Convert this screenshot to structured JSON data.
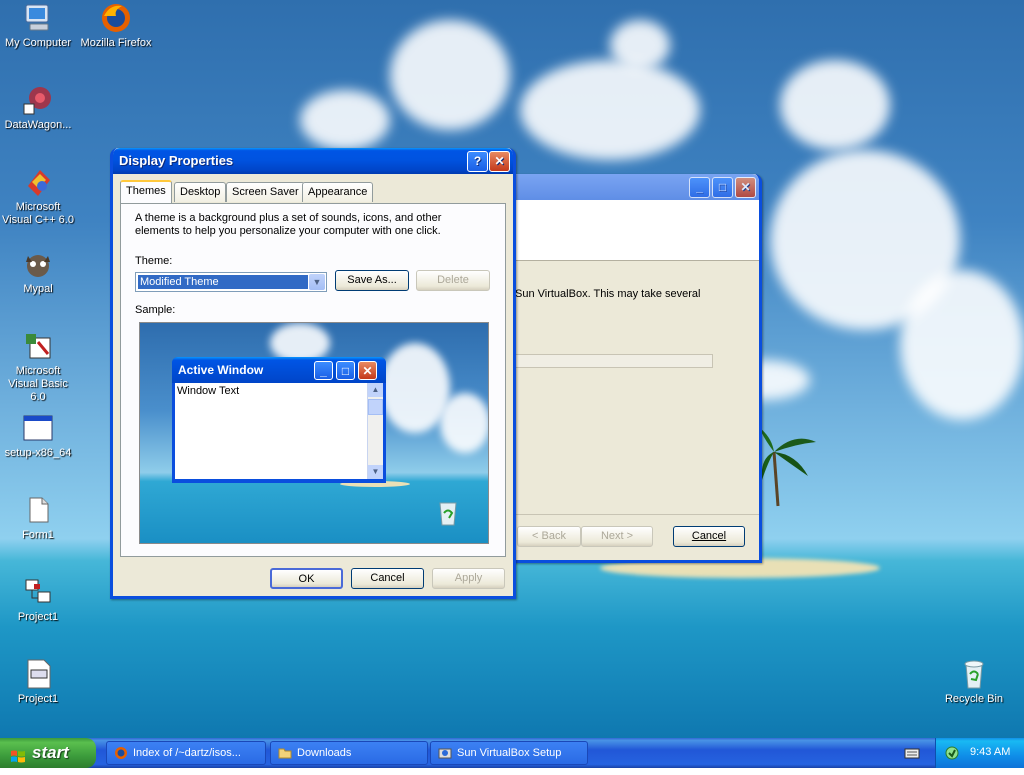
{
  "desktop": {
    "icons": [
      {
        "label": "My Computer",
        "icon": "my-computer-icon"
      },
      {
        "label": "Mozilla Firefox",
        "icon": "firefox-icon"
      },
      {
        "label": "DataWagon...",
        "icon": "datawagon-icon"
      },
      {
        "label": "Microsoft Visual C++ 6.0",
        "icon": "visual-cpp-icon"
      },
      {
        "label": "Mypal",
        "icon": "mypal-icon"
      },
      {
        "label": "Microsoft Visual Basic 6.0",
        "icon": "visual-basic-icon"
      },
      {
        "label": "setup-x86_64",
        "icon": "setup-exe-icon"
      },
      {
        "label": "Form1",
        "icon": "form-file-icon"
      },
      {
        "label": "Project1",
        "icon": "vb-project-icon"
      },
      {
        "label": "Project1",
        "icon": "vb-project-file-icon"
      },
      {
        "label": "Recycle Bin",
        "icon": "recycle-bin-icon"
      }
    ]
  },
  "setup_window": {
    "text": "Sun VirtualBox. This may take several",
    "back_label": "< Back",
    "next_label": "Next >",
    "cancel_label": "Cancel"
  },
  "display_properties": {
    "title": "Display Properties",
    "tabs": [
      "Themes",
      "Desktop",
      "Screen Saver",
      "Appearance"
    ],
    "active_tab": "Themes",
    "description": "A theme is a background plus a set of sounds, icons, and other elements to help you personalize your computer with one click.",
    "theme_label": "Theme:",
    "theme_value": "Modified Theme",
    "save_as_label": "Save As...",
    "delete_label": "Delete",
    "sample_label": "Sample:",
    "sample": {
      "window_title": "Active Window",
      "window_text": "Window Text"
    },
    "ok_label": "OK",
    "cancel_label": "Cancel",
    "apply_label": "Apply"
  },
  "taskbar": {
    "start_label": "start",
    "tasks": [
      {
        "label": "Index of /~dartz/isos...",
        "icon": "firefox-icon"
      },
      {
        "label": "Downloads",
        "icon": "folder-icon"
      },
      {
        "label": "Sun VirtualBox Setup",
        "icon": "installer-icon"
      }
    ],
    "clock": "9:43 AM"
  }
}
